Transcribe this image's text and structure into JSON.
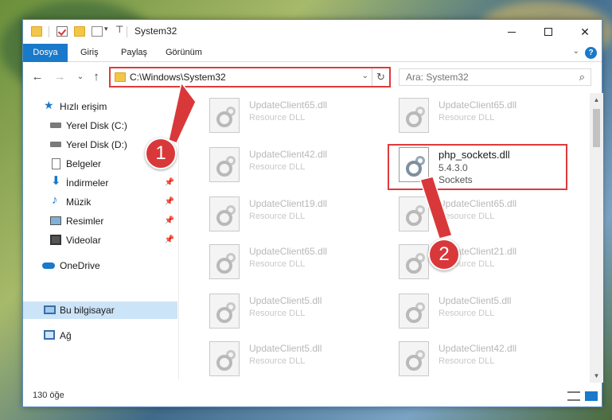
{
  "window": {
    "title": "System32"
  },
  "ribbon": {
    "tabs": [
      "Dosya",
      "Giriş",
      "Paylaş",
      "Görünüm"
    ]
  },
  "address": {
    "path": "C:\\Windows\\System32"
  },
  "search": {
    "placeholder": "Ara: System32"
  },
  "sidebar": {
    "items": [
      {
        "label": "Hızlı erişim",
        "icon": "star-icon",
        "pinned": false
      },
      {
        "label": "Yerel Disk (C:)",
        "icon": "drive-icon",
        "pinned": false
      },
      {
        "label": "Yerel Disk (D:)",
        "icon": "drive-icon",
        "pinned": false
      },
      {
        "label": "Belgeler",
        "icon": "document-icon",
        "pinned": false
      },
      {
        "label": "İndirmeler",
        "icon": "download-icon",
        "pinned": true
      },
      {
        "label": "Müzik",
        "icon": "music-icon",
        "pinned": true
      },
      {
        "label": "Resimler",
        "icon": "pictures-icon",
        "pinned": true
      },
      {
        "label": "Videolar",
        "icon": "video-icon",
        "pinned": true
      },
      {
        "label": "OneDrive",
        "icon": "cloud-icon",
        "pinned": false
      },
      {
        "label": "Bu bilgisayar",
        "icon": "computer-icon",
        "pinned": false,
        "selected": true
      },
      {
        "label": "Ağ",
        "icon": "network-icon",
        "pinned": false
      }
    ]
  },
  "files": [
    {
      "name": "UpdateClient65.dll",
      "desc": "Resource DLL"
    },
    {
      "name": "UpdateClient65.dll",
      "desc": "Resource DLL"
    },
    {
      "name": "UpdateClient42.dll",
      "desc": "Resource DLL"
    },
    {
      "name": "php_sockets.dll",
      "desc": "5.4.3.0",
      "sub": "Sockets",
      "active": true
    },
    {
      "name": "UpdateClient19.dll",
      "desc": "Resource DLL"
    },
    {
      "name": "UpdateClient65.dll",
      "desc": "Resource DLL"
    },
    {
      "name": "UpdateClient65.dll",
      "desc": "Resource DLL"
    },
    {
      "name": "UpdateClient21.dll",
      "desc": "Resource DLL"
    },
    {
      "name": "UpdateClient5.dll",
      "desc": "Resource DLL"
    },
    {
      "name": "UpdateClient5.dll",
      "desc": "Resource DLL"
    },
    {
      "name": "UpdateClient5.dll",
      "desc": "Resource DLL"
    },
    {
      "name": "UpdateClient42.dll",
      "desc": "Resource DLL"
    }
  ],
  "status": {
    "count": "130 öğe"
  },
  "annotations": {
    "marker1": "1",
    "marker2": "2",
    "color": "#d9383a"
  },
  "colors": {
    "accent": "#1979ca",
    "highlight": "#e03a3a",
    "selected_bg": "#cce4f7"
  }
}
